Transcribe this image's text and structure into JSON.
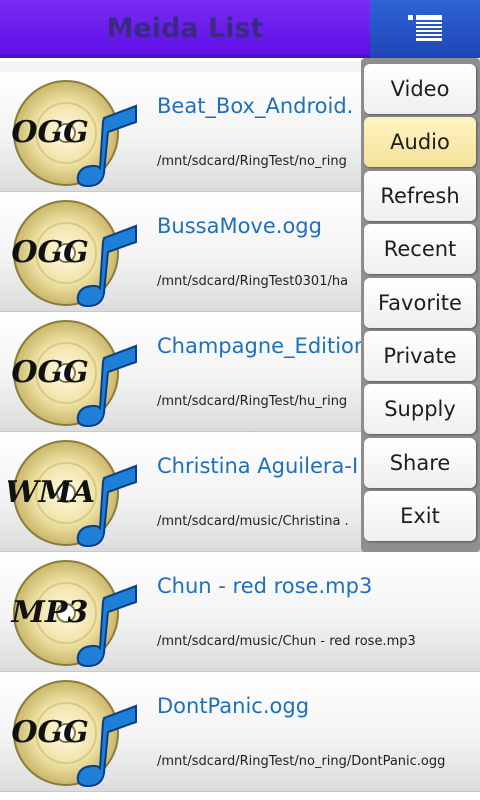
{
  "header": {
    "title": "Meida List",
    "menu_icon": "list-menu-icon"
  },
  "colors": {
    "header_purple": "#6a1bf0",
    "menu_blue": "#2a55c8",
    "title_text": "#3b2a82",
    "item_title": "#1f6fbf",
    "menu_highlight": "#f6e7a6"
  },
  "media_items": [
    {
      "title": "Beat_Box_Android.",
      "path": "/mnt/sdcard/RingTest/no_ring",
      "format": "OGG"
    },
    {
      "title": "BussaMove.ogg",
      "path": "/mnt/sdcard/RingTest0301/ha",
      "format": "OGG"
    },
    {
      "title": "Champagne_Edition",
      "path": "/mnt/sdcard/RingTest/hu_ring",
      "format": "OGG"
    },
    {
      "title": "Christina Aguilera-I",
      "path": "/mnt/sdcard/music/Christina .",
      "format": "WMA"
    },
    {
      "title": "Chun - red rose.mp3",
      "path": "/mnt/sdcard/music/Chun - red rose.mp3",
      "format": "MP3"
    },
    {
      "title": "DontPanic.ogg",
      "path": "/mnt/sdcard/RingTest/no_ring/DontPanic.ogg",
      "format": "OGG"
    }
  ],
  "popup_menu": {
    "items": [
      {
        "label": "Video"
      },
      {
        "label": "Audio",
        "selected": true
      },
      {
        "label": "Refresh"
      },
      {
        "label": "Recent"
      },
      {
        "label": "Favorite"
      },
      {
        "label": "Private"
      },
      {
        "label": "Supply"
      },
      {
        "label": "Share"
      },
      {
        "label": "Exit"
      }
    ]
  }
}
